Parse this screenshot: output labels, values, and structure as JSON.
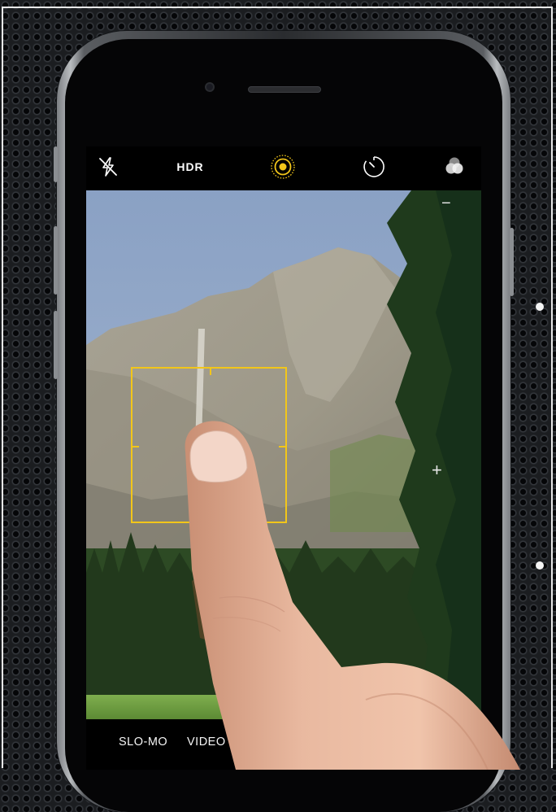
{
  "camera_topbar": {
    "flash_icon": "flash-off-icon",
    "hdr_label": "HDR",
    "live_photo_icon": "live-photo-icon",
    "timer_icon": "timer-icon",
    "filters_icon": "filters-icon"
  },
  "viewfinder": {
    "zoom_minus": "−",
    "zoom_plus": "+"
  },
  "camera_modes": {
    "items": [
      "SLO-MO",
      "VIDEO"
    ]
  },
  "colors": {
    "focus_box": "#f2c61a",
    "live_photo_active": "#f2c61a"
  }
}
